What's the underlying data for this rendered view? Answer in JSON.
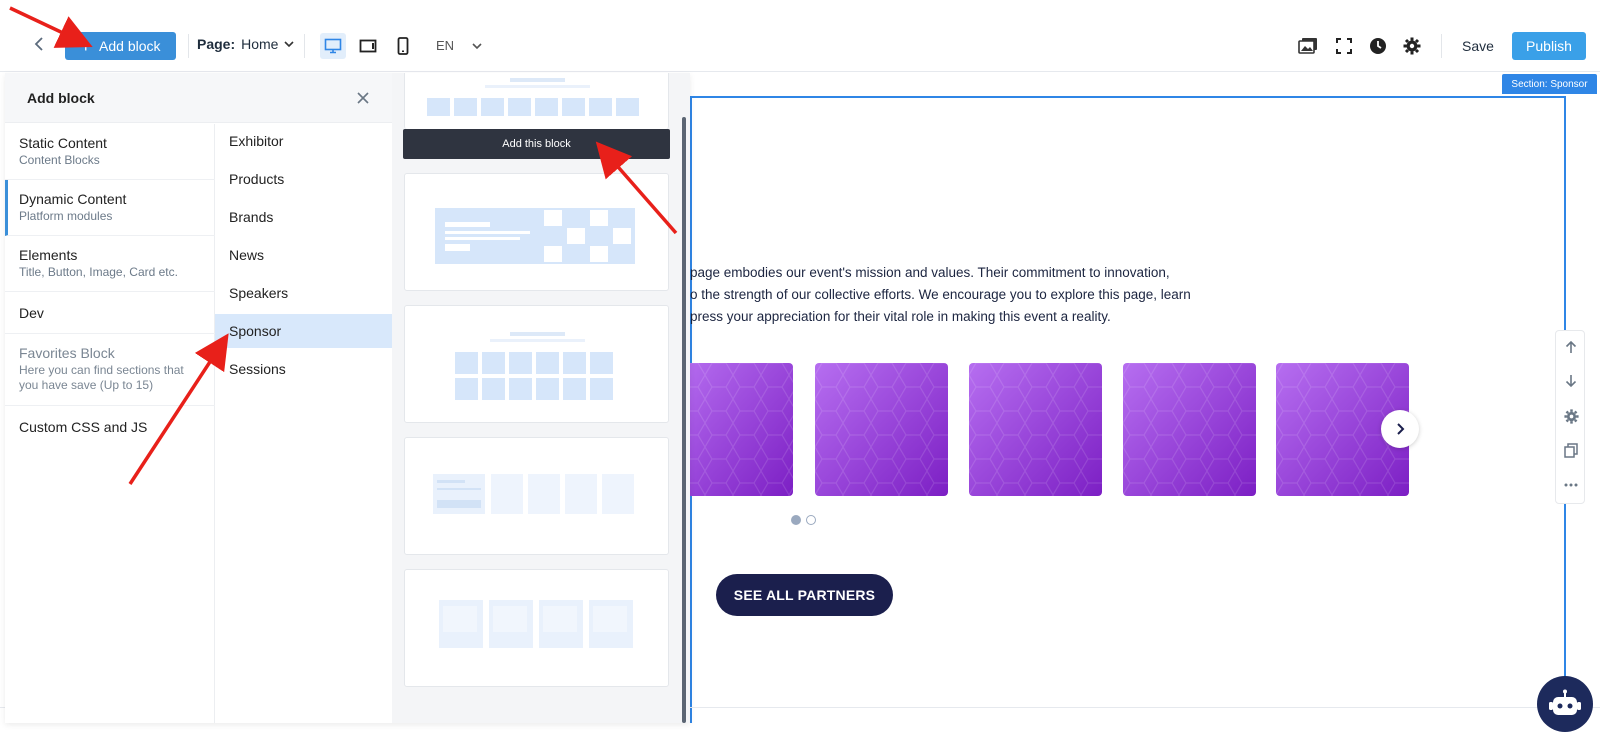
{
  "toolbar": {
    "add_block_label": "Add block",
    "page_label": "Page:",
    "page_value": "Home",
    "language": "EN",
    "save_label": "Save",
    "publish_label": "Publish"
  },
  "panel": {
    "title": "Add block",
    "categories": [
      {
        "title": "Static Content",
        "subtitle": "Content Blocks"
      },
      {
        "title": "Dynamic Content",
        "subtitle": "Platform modules"
      },
      {
        "title": "Elements",
        "subtitle": "Title, Button, Image, Card etc."
      },
      {
        "title": "Dev",
        "subtitle": ""
      },
      {
        "title": "Favorites Block",
        "subtitle": "Here you can find sections that you have save (Up to 15)"
      },
      {
        "title": "Custom CSS and JS",
        "subtitle": ""
      }
    ],
    "subcategories": [
      "Exhibitor",
      "Products",
      "Brands",
      "News",
      "Speakers",
      "Sponsor",
      "Sessions"
    ],
    "add_this_block_label": "Add this block"
  },
  "canvas": {
    "section_label": "Section: Sponsor",
    "intro_lines": [
      "page embodies our event's mission and values. Their commitment to innovation,",
      "o the strength of our collective efforts. We encourage you to explore this page, learn",
      "press your appreciation for their vital role in making this event a reality."
    ],
    "see_all_label": "SEE ALL PARTNERS"
  },
  "colors": {
    "accent": "#3a8fd9",
    "publish": "#3aa0e8",
    "section_border": "#2f86e6",
    "cta": "#1b1f4d",
    "tile_purple": "#9b3fe0",
    "annotation_arrow": "#e8201a"
  }
}
